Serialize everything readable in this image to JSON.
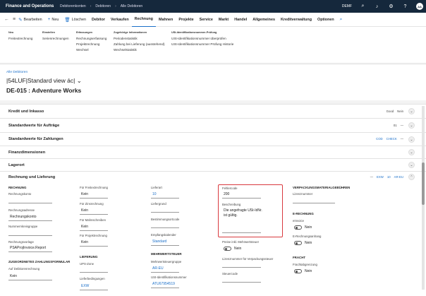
{
  "topbar": {
    "app_name": "Finance and Operations",
    "breadcrumbs": [
      "Debitorenkonten",
      "Debitoren",
      "Alle Debitoren"
    ],
    "company": "DEMF",
    "icons": [
      "search-icon",
      "bell-icon",
      "gear-icon",
      "help-icon"
    ],
    "avatar_initials": "AA"
  },
  "actionbar": {
    "edit": "Bearbeiten",
    "new": "Neu",
    "delete": "Löschen",
    "tabs": [
      "Debitor",
      "Verkaufen",
      "Rechnung",
      "Mahnen",
      "Projekte",
      "Service",
      "Markt",
      "Handel",
      "Allgemeines",
      "Kreditverwaltung",
      "Optionen"
    ],
    "active_tab": "Rechnung"
  },
  "ribbon": {
    "groups": [
      {
        "header": "Neu",
        "items": [
          "Freitextrechnung"
        ]
      },
      {
        "header": "Einstellen",
        "items": [
          "Serienrechnungen"
        ]
      },
      {
        "header": "Erfassungen",
        "items": [
          "Rechnungserfassung",
          "Projektrechnung",
          "Wechsel"
        ]
      },
      {
        "header": "Zugehörige Informationen",
        "items": [
          "Periodenstatistik",
          "Zahlung bei Lieferung (ausstehend)",
          "Wechselstatistik"
        ]
      },
      {
        "header": "USt-Identifikationsnummer-Prüfung",
        "items": [
          "USt-Identifikationsnummer überprüfen",
          "USt-Identifikationsnummer Prüfung Historie"
        ]
      }
    ]
  },
  "header": {
    "back_link": "Alle Debitoren",
    "view_title": "|54LUF|Standard view ác|",
    "record_title": "DE-015 : Adventure Works"
  },
  "fasttabs": [
    {
      "title": "Kredit und Inkasso",
      "tags": [
        "Good",
        "Nein"
      ]
    },
    {
      "title": "Standardwerte für Aufträge",
      "tags": [
        "01",
        "—"
      ]
    },
    {
      "title": "Standardwerte für Zahlungen",
      "tags": [
        "COD",
        "CHECK",
        "—"
      ]
    },
    {
      "title": "Finanzdimensionen",
      "tags": []
    },
    {
      "title": "Lagerort",
      "tags": []
    },
    {
      "title": "Rechnung und Lieferung",
      "tags": [
        "—",
        "EXW",
        "10",
        "AR-EU"
      ]
    }
  ],
  "invoice": {
    "col1": {
      "section": "RECHNUNG",
      "fields": [
        {
          "label": "Rechnungskonto",
          "value": ""
        },
        {
          "label": "Rechnungsadresse",
          "value": "Rechnungskonto"
        },
        {
          "label": "Nummernkreisgruppe",
          "value": ""
        },
        {
          "label": "Rechnungsvorlage",
          "value": "PSAProjInvoice.Report"
        }
      ],
      "section2": "ZUGEORDNETES ZAHLUNGSFORMULAR",
      "fields2": [
        {
          "label": "Auf Debitorenrechnung",
          "value": "Kein"
        }
      ]
    },
    "col2": {
      "fields": [
        {
          "label": "Für Freitextrechnung",
          "value": "Kein"
        },
        {
          "label": "Für Zinsrechnung",
          "value": "Kein"
        },
        {
          "label": "Für Mahnschreiben",
          "value": "Kein"
        },
        {
          "label": "Für Projektrechnung",
          "value": "Kein"
        }
      ],
      "section": "LIEFERUNG",
      "fields2": [
        {
          "label": "UPS-Zone",
          "value": ""
        },
        {
          "label": "Lieferbedingungen",
          "value": "EXW"
        }
      ]
    },
    "col3": {
      "fields": [
        {
          "label": "Lieferart",
          "value": "10"
        },
        {
          "label": "Liefergrund",
          "value": ""
        },
        {
          "label": "Bestimmungsortcode",
          "value": ""
        },
        {
          "label": "Empfangskalender",
          "value": "Standard"
        }
      ],
      "section": "MEHRWERTSTEUER",
      "fields2": [
        {
          "label": "Mehrwertsteuergruppe",
          "value": "AR-EU"
        },
        {
          "label": "USt-Identifikationsnummer",
          "value": "ATU67954519"
        }
      ]
    },
    "col4": {
      "error_code_label": "Fehlercode",
      "error_code_value": "200",
      "description_label": "Beschreibung",
      "description_value": "Die angefragte USt-IdNr. ist gültig.",
      "prices_incl_vat_label": "Preise inkl. Mehrwertsteuer",
      "prices_incl_vat_value": "Nein",
      "license_label": "Lizenznummer für Verpackungssteuer",
      "tax_code_label": "Steuercode"
    },
    "col5": {
      "section": "VERPACKUNGSMATERIALGEBÜHREN",
      "license_label": "Lizenznummer",
      "section2": "E-RECHNUNG",
      "einvoice_label": "eInvoice",
      "einvoice_value": "Nein",
      "attachment_label": "E-Rechnungsanhang",
      "attachment_value": "Nein",
      "section3": "FRACHT",
      "freight_label": "Frachtabgrenzung",
      "freight_value": "Nein"
    }
  }
}
